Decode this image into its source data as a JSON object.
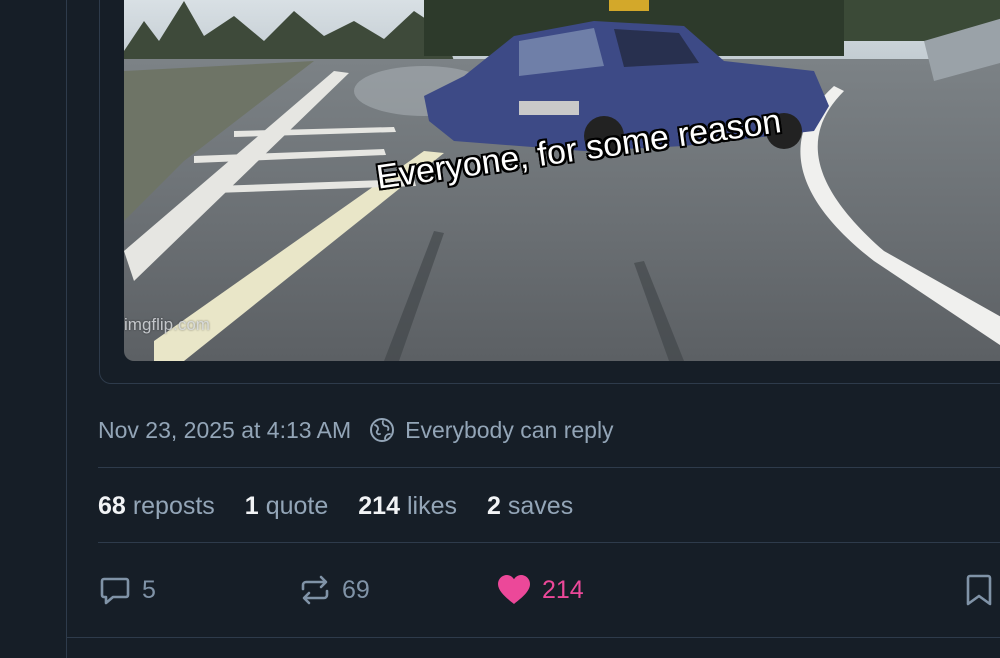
{
  "media": {
    "caption": "Everyone, for some reason",
    "watermark": "imgflip.com"
  },
  "post_meta": {
    "timestamp": "Nov 23, 2025 at 4:13 AM",
    "reply_setting": "Everybody can reply",
    "reply_icon": "globe-icon"
  },
  "stats": {
    "reposts_count": "68",
    "reposts_label": "reposts",
    "quotes_count": "1",
    "quotes_label": "quote",
    "likes_count": "214",
    "likes_label": "likes",
    "saves_count": "2",
    "saves_label": "saves"
  },
  "actions": {
    "reply_count": "5",
    "repost_count": "69",
    "like_count": "214",
    "reply_icon": "reply-bubble-icon",
    "repost_icon": "repost-icon",
    "like_icon": "heart-filled-icon",
    "bookmark_icon": "bookmark-icon"
  },
  "colors": {
    "background": "#161e27",
    "border": "#2e3b4b",
    "muted_text": "#93a5b7",
    "strong_text": "#f1f3f5",
    "like_accent": "#ec4899"
  }
}
